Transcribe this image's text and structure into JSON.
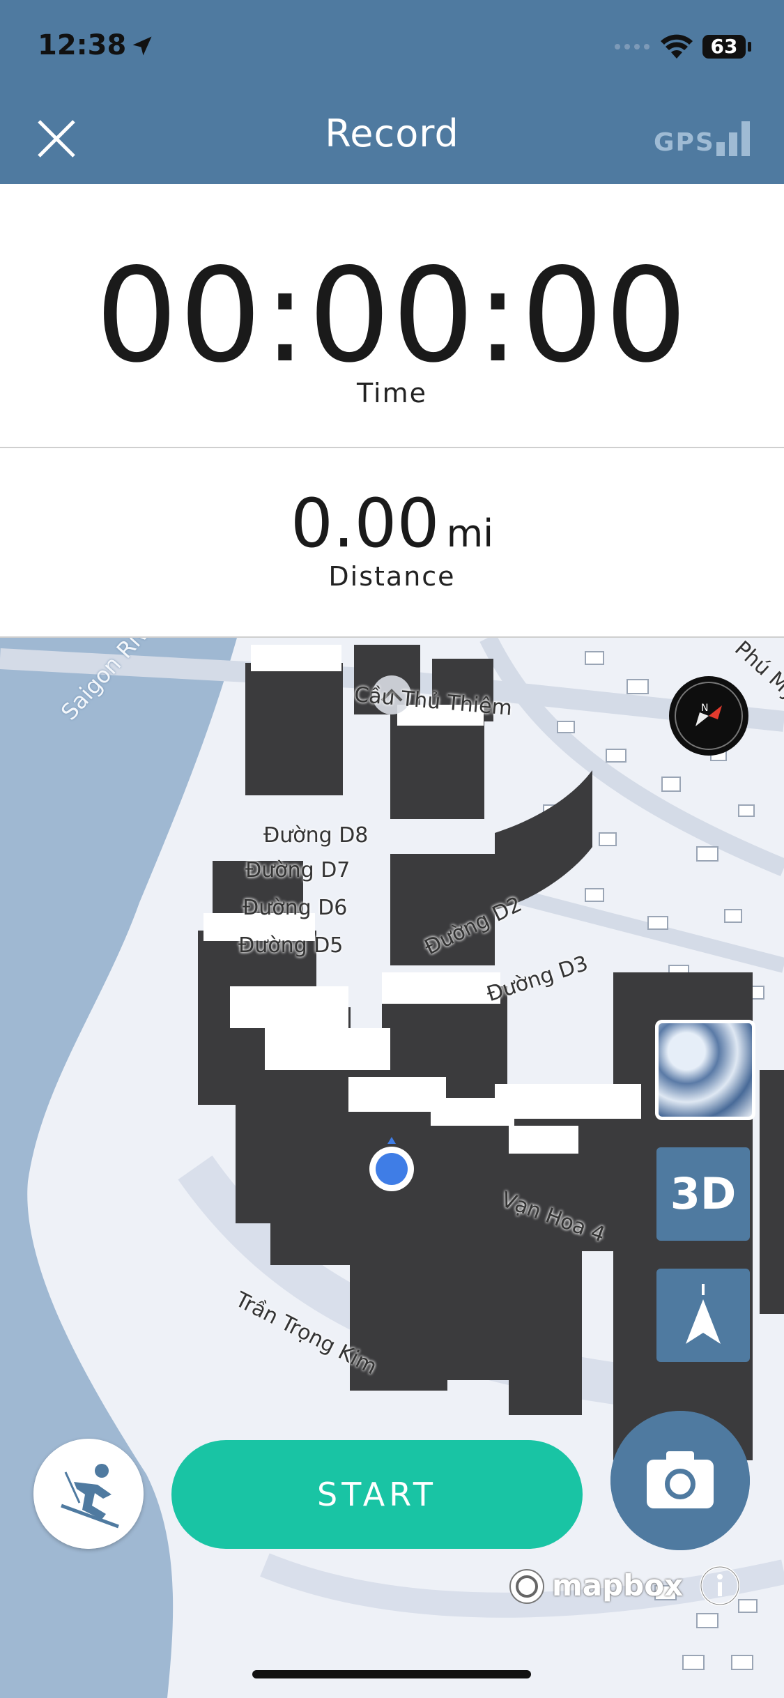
{
  "status_bar": {
    "time": "12:38",
    "battery": "63"
  },
  "header": {
    "title": "Record",
    "gps_label": "GPS"
  },
  "time_panel": {
    "value": "00:00:00",
    "label": "Time"
  },
  "distance_panel": {
    "value": "0.00",
    "unit": "mi",
    "label": "Distance"
  },
  "map": {
    "labels": {
      "river": "Saigon River",
      "bridge": "Cầu Thủ Thiêm",
      "phu_my": "Phú Mỹ",
      "d8": "Đường D8",
      "d7": "Đường D7",
      "d6": "Đường D6",
      "d5": "Đường D5",
      "d2": "Đường D2",
      "d3": "Đường D3",
      "van_hoa": "Vạn Hoa 4",
      "tran_trong_kim": "Trần Trọng Kim"
    },
    "button_3d": "3D",
    "attribution": "mapbox"
  },
  "actions": {
    "start_label": "START"
  },
  "colors": {
    "header": "#4f7aa0",
    "start": "#19c4a4",
    "river": "#9fb8d2"
  }
}
